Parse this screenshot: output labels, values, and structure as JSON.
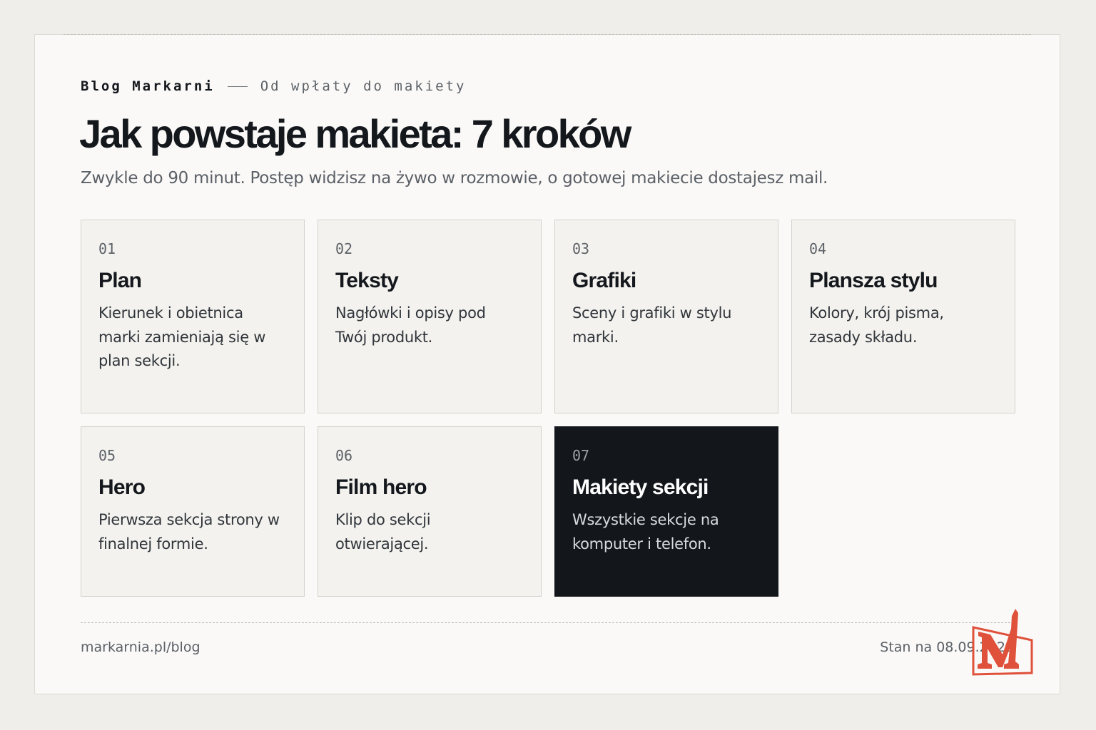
{
  "header": {
    "brand": "Blog Markarni",
    "section": "Od wpłaty do makiety",
    "title": "Jak powstaje makieta: 7 kroków",
    "lead": "Zwykle do 90 minut. Postęp widzisz na żywo w rozmowie, o gotowej makiecie dostajesz mail."
  },
  "steps": [
    {
      "num": "01",
      "name": "Plan",
      "desc": "Kierunek i obietnica marki zamieniają się w plan sekcji."
    },
    {
      "num": "02",
      "name": "Teksty",
      "desc": "Nagłówki i opisy pod Twój produkt."
    },
    {
      "num": "03",
      "name": "Grafiki",
      "desc": "Sceny i grafiki w stylu marki."
    },
    {
      "num": "04",
      "name": "Plansza stylu",
      "desc": "Kolory, krój pisma, zasady składu."
    },
    {
      "num": "05",
      "name": "Hero",
      "desc": "Pierwsza sekcja strony w finalnej formie."
    },
    {
      "num": "06",
      "name": "Film hero",
      "desc": "Klip do sekcji otwierającej."
    },
    {
      "num": "07",
      "name": "Makiety sekcji",
      "desc": "Wszystkie sekcje na komputer i telefon."
    }
  ],
  "footer": {
    "url": "markarnia.pl/blog",
    "date": "Stan na 08.09.2026"
  },
  "colors": {
    "page_bg": "#efeeea",
    "card_bg": "#faf9f7",
    "step_bg": "#f3f2ee",
    "highlight_bg": "#13171c",
    "ink": "#14181d",
    "muted": "#5b6067",
    "logo_red": "#e0513b"
  },
  "icons": {
    "logo": "markarnia-m-logo"
  }
}
